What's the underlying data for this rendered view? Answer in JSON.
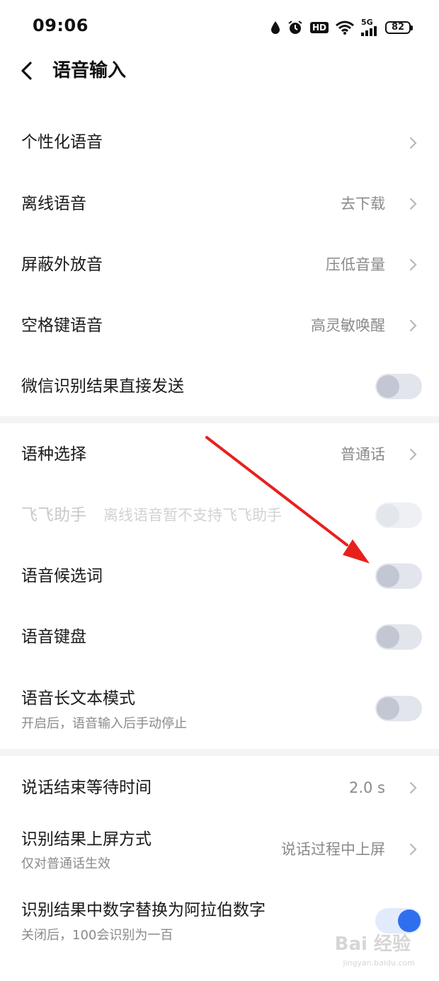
{
  "status_bar": {
    "time": "09:06",
    "hd_label": "HD",
    "signal_label": "5G",
    "battery": "82",
    "icons": [
      "drop-icon",
      "alarm-icon",
      "hd-icon",
      "wifi-icon",
      "signal-icon",
      "battery-icon"
    ]
  },
  "header": {
    "title": "语音输入",
    "back_icon": "chevron-left-icon"
  },
  "section1": [
    {
      "label": "个性化语音",
      "value": ""
    },
    {
      "label": "离线语音",
      "value": "去下载"
    },
    {
      "label": "屏蔽外放音",
      "value": "压低音量"
    },
    {
      "label": "空格键语音",
      "value": "高灵敏唤醒"
    },
    {
      "label": "微信识别结果直接发送",
      "toggle": "off"
    }
  ],
  "section2": [
    {
      "label": "语种选择",
      "value": "普通话"
    },
    {
      "label": "飞飞助手",
      "note": "离线语音暂不支持飞飞助手",
      "toggle": "disabled"
    },
    {
      "label": "语音候选词",
      "toggle": "off"
    },
    {
      "label": "语音键盘",
      "toggle": "off"
    },
    {
      "label": "语音长文本模式",
      "sub": "开启后，语音输入后手动停止",
      "toggle": "off"
    }
  ],
  "section3": [
    {
      "label": "说话结束等待时间",
      "value": "2.0 s"
    },
    {
      "label": "识别结果上屏方式",
      "sub": "仅对普通话生效",
      "value": "说话过程中上屏"
    },
    {
      "label": "识别结果中数字替换为阿拉伯数字",
      "sub": "关闭后，100会识别为一百",
      "toggle": "on"
    }
  ],
  "watermark": {
    "text": "Bai 经验",
    "sub": "jingyan.baidu.com"
  },
  "colors": {
    "accent": "#2f6fee",
    "toggle_off_track": "#e2e5ec",
    "toggle_off_knob": "#c2c7d3",
    "annotation_arrow": "#e8201c"
  }
}
